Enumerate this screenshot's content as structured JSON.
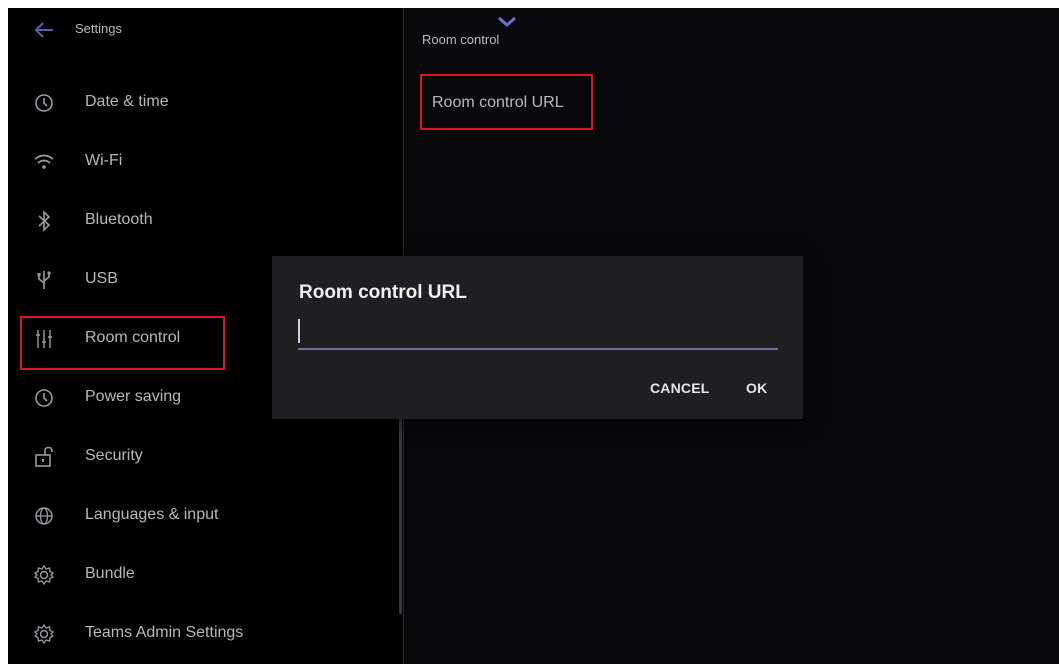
{
  "header": {
    "title": "Settings"
  },
  "sidebar": {
    "items": [
      {
        "label": "Date & time",
        "icon": "clock-icon"
      },
      {
        "label": "Wi-Fi",
        "icon": "wifi-icon"
      },
      {
        "label": "Bluetooth",
        "icon": "bluetooth-icon"
      },
      {
        "label": "USB",
        "icon": "usb-icon"
      },
      {
        "label": "Room control",
        "icon": "sliders-icon"
      },
      {
        "label": "Power saving",
        "icon": "clock-icon"
      },
      {
        "label": "Security",
        "icon": "unlock-icon"
      },
      {
        "label": "Languages & input",
        "icon": "globe-icon"
      },
      {
        "label": "Bundle",
        "icon": "gear-icon"
      },
      {
        "label": "Teams Admin Settings",
        "icon": "gear-icon"
      }
    ]
  },
  "main": {
    "title": "Room control",
    "items": [
      {
        "label": "Room control URL"
      }
    ]
  },
  "dialog": {
    "title": "Room control URL",
    "input_value": "",
    "cancel_label": "CANCEL",
    "ok_label": "OK"
  },
  "colors": {
    "background": "#000000",
    "dialog_bg": "#1f1f22",
    "highlight": "#e0161e",
    "accent": "#6f6fcf"
  }
}
